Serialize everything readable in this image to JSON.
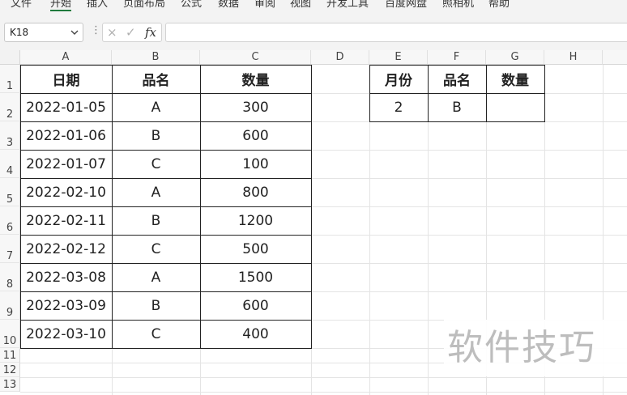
{
  "ribbon": {
    "tabs": [
      {
        "label": "文件",
        "active": false
      },
      {
        "label": "开始",
        "active": true
      },
      {
        "label": "插入",
        "active": false
      },
      {
        "label": "页面布局",
        "active": false
      },
      {
        "label": "公式",
        "active": false
      },
      {
        "label": "数据",
        "active": false
      },
      {
        "label": "审阅",
        "active": false
      },
      {
        "label": "视图",
        "active": false
      },
      {
        "label": "开发工具",
        "active": false
      },
      {
        "label": "百度网盘",
        "active": false
      },
      {
        "label": "照相机",
        "active": false
      },
      {
        "label": "帮助",
        "active": false
      }
    ]
  },
  "formula_bar": {
    "name_box": "K18",
    "cancel_icon": "×",
    "confirm_icon": "✓",
    "fx_label": "fx",
    "formula": ""
  },
  "columns": [
    "A",
    "B",
    "C",
    "D",
    "E",
    "F",
    "G",
    "H"
  ],
  "rows": [
    "1",
    "2",
    "3",
    "4",
    "5",
    "6",
    "7",
    "8",
    "9",
    "10",
    "11",
    "12",
    "13"
  ],
  "table1": {
    "headers": [
      "日期",
      "品名",
      "数量"
    ],
    "rows": [
      [
        "2022-01-05",
        "A",
        "300"
      ],
      [
        "2022-01-06",
        "B",
        "600"
      ],
      [
        "2022-01-07",
        "C",
        "100"
      ],
      [
        "2022-02-10",
        "A",
        "800"
      ],
      [
        "2022-02-11",
        "B",
        "1200"
      ],
      [
        "2022-02-12",
        "C",
        "500"
      ],
      [
        "2022-03-08",
        "A",
        "1500"
      ],
      [
        "2022-03-09",
        "B",
        "600"
      ],
      [
        "2022-03-10",
        "C",
        "400"
      ]
    ]
  },
  "table2": {
    "headers": [
      "月份",
      "品名",
      "数量"
    ],
    "rows": [
      [
        "2",
        "B",
        ""
      ]
    ]
  },
  "watermark": "软件技巧",
  "colors": {
    "accent": "#1f7a3d",
    "grid": "#e4e4e4",
    "border": "#222222"
  }
}
